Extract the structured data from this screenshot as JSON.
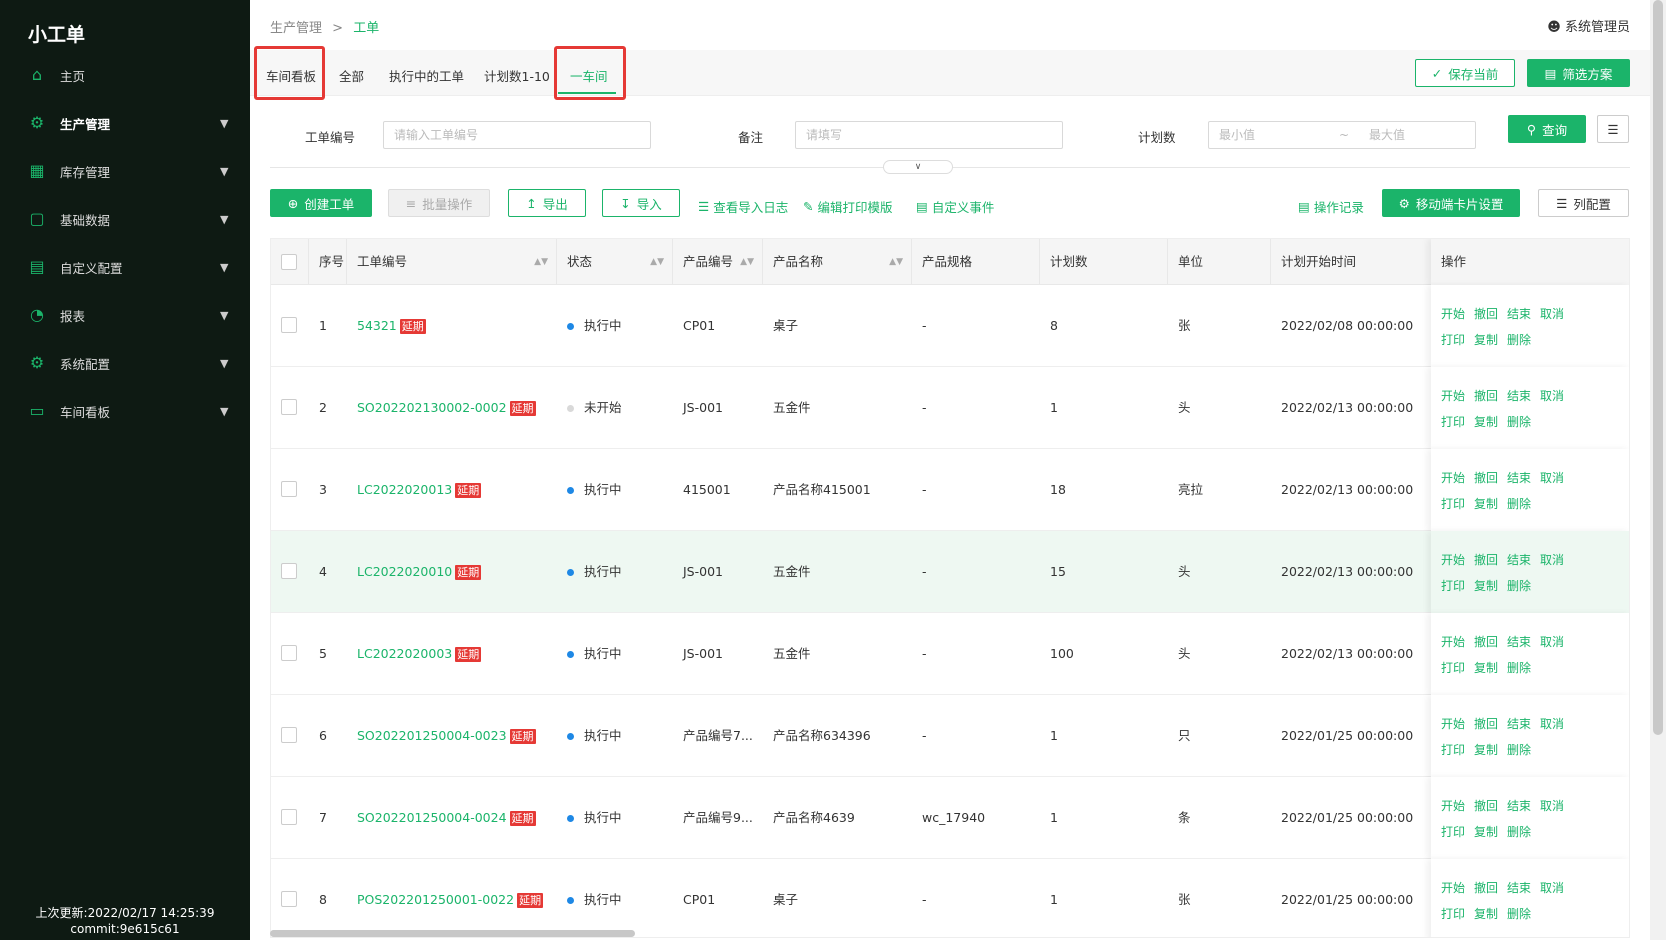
{
  "app": {
    "logo": "小工单"
  },
  "sidebar": {
    "items": [
      {
        "label": "主页",
        "icon": "home-icon",
        "glyph": "⌂"
      },
      {
        "label": "生产管理",
        "icon": "production-icon",
        "glyph": "⚙"
      },
      {
        "label": "库存管理",
        "icon": "warehouse-icon",
        "glyph": "▦"
      },
      {
        "label": "基础数据",
        "icon": "book-icon",
        "glyph": "▢"
      },
      {
        "label": "自定义配置",
        "icon": "config-icon",
        "glyph": "▤"
      },
      {
        "label": "报表",
        "icon": "chart-icon",
        "glyph": "◔"
      },
      {
        "label": "系统配置",
        "icon": "system-icon",
        "glyph": "⚙"
      },
      {
        "label": "车间看板",
        "icon": "monitor-icon",
        "glyph": "▭"
      }
    ],
    "footer_update": "上次更新:2022/02/17 14:25:39",
    "footer_commit": "commit:9e615c61"
  },
  "header": {
    "breadcrumb_parent": "生产管理",
    "breadcrumb_sep": ">",
    "breadcrumb_current": "工单",
    "user": "系统管理员"
  },
  "tabs": [
    {
      "label": "车间看板"
    },
    {
      "label": "全部"
    },
    {
      "label": "执行中的工单"
    },
    {
      "label": "计划数1-10"
    },
    {
      "label": "一车间"
    }
  ],
  "actions": {
    "save_current": "保存当前",
    "filter_scheme": "筛选方案",
    "query": "查询"
  },
  "filters": {
    "order_no_label": "工单编号",
    "order_no_placeholder": "请输入工单编号",
    "remark_label": "备注",
    "remark_placeholder": "请填写",
    "plan_label": "计划数",
    "plan_min": "最小值",
    "plan_sep": "~",
    "plan_max": "最大值"
  },
  "toolbar": {
    "create": "创建工单",
    "batch": "批量操作",
    "export": "导出",
    "import": "导入",
    "import_log": "查看导入日志",
    "print_template": "编辑打印模版",
    "custom_event": "自定义事件",
    "op_record": "操作记录",
    "mobile_card": "移动端卡片设置",
    "columns": "列配置"
  },
  "table": {
    "headers": [
      "序号",
      "工单编号",
      "状态",
      "产品编号",
      "产品名称",
      "产品规格",
      "计划数",
      "单位",
      "计划开始时间",
      "操作"
    ],
    "ops_line1": [
      "开始",
      "撤回",
      "结束",
      "取消"
    ],
    "ops_line2": [
      "打印",
      "复制",
      "删除"
    ],
    "status_colors": {
      "执行中": "#1e88e5",
      "未开始": "#d9d9d9"
    },
    "rows": [
      {
        "idx": "1",
        "code": "54321",
        "tag": "延期",
        "status": "执行中",
        "product_code": "CP01",
        "product_name": "桌子",
        "spec": "-",
        "plan": "8",
        "unit": "张",
        "start": "2022/02/08 00:00:00"
      },
      {
        "idx": "2",
        "code": "SO202202130002-0002",
        "tag": "延期",
        "status": "未开始",
        "product_code": "JS-001",
        "product_name": "五金件",
        "spec": "-",
        "plan": "1",
        "unit": "头",
        "start": "2022/02/13 00:00:00"
      },
      {
        "idx": "3",
        "code": "LC2022020013",
        "tag": "延期",
        "status": "执行中",
        "product_code": "415001",
        "product_name": "产品名称415001",
        "spec": "-",
        "plan": "18",
        "unit": "亮拉",
        "start": "2022/02/13 00:00:00"
      },
      {
        "idx": "4",
        "code": "LC2022020010",
        "tag": "延期",
        "status": "执行中",
        "product_code": "JS-001",
        "product_name": "五金件",
        "spec": "-",
        "plan": "15",
        "unit": "头",
        "start": "2022/02/13 00:00:00"
      },
      {
        "idx": "5",
        "code": "LC2022020003",
        "tag": "延期",
        "status": "执行中",
        "product_code": "JS-001",
        "product_name": "五金件",
        "spec": "-",
        "plan": "100",
        "unit": "头",
        "start": "2022/02/13 00:00:00"
      },
      {
        "idx": "6",
        "code": "SO202201250004-0023",
        "tag": "延期",
        "status": "执行中",
        "product_code": "产品编号7...",
        "product_name": "产品名称634396",
        "spec": "-",
        "plan": "1",
        "unit": "只",
        "start": "2022/01/25 00:00:00"
      },
      {
        "idx": "7",
        "code": "SO202201250004-0024",
        "tag": "延期",
        "status": "执行中",
        "product_code": "产品编号9...",
        "product_name": "产品名称4639",
        "spec": "wc_17940",
        "plan": "1",
        "unit": "条",
        "start": "2022/01/25 00:00:00"
      },
      {
        "idx": "8",
        "code": "POS202201250001-0022",
        "tag": "延期",
        "status": "执行中",
        "product_code": "CP01",
        "product_name": "桌子",
        "spec": "-",
        "plan": "1",
        "unit": "张",
        "start": "2022/01/25 00:00:00"
      }
    ]
  }
}
